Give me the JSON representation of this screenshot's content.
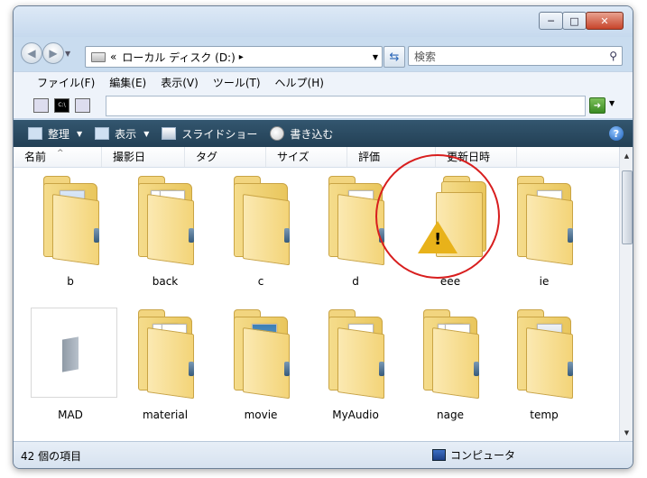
{
  "window": {
    "controls": {
      "minimize": "─",
      "maximize": "□",
      "close": "✕"
    }
  },
  "nav": {
    "back_glyph": "◀",
    "forward_glyph": "▶",
    "address": {
      "prefix": "«",
      "location": "ローカル ディスク (D:)",
      "separator": "▸"
    },
    "search_placeholder": "検索"
  },
  "menu": [
    "ファイル(F)",
    "編集(E)",
    "表示(V)",
    "ツール(T)",
    "ヘルプ(H)"
  ],
  "toolbar2": {
    "cmd_label": "C:\\"
  },
  "command_bar": {
    "organize": "整理",
    "view": "表示",
    "slideshow": "スライドショー",
    "burn": "書き込む",
    "help": "?"
  },
  "columns": [
    "名前",
    "撮影日",
    "タグ",
    "サイズ",
    "評価",
    "更新日時"
  ],
  "items": [
    {
      "name": "b"
    },
    {
      "name": "back"
    },
    {
      "name": "c"
    },
    {
      "name": "d"
    },
    {
      "name": "eee"
    },
    {
      "name": "ie"
    },
    {
      "name": "MAD"
    },
    {
      "name": "material"
    },
    {
      "name": "movie"
    },
    {
      "name": "MyAudio"
    },
    {
      "name": "nage"
    },
    {
      "name": "temp"
    }
  ],
  "status": {
    "count": "42 個の項目",
    "zone": "コンピュータ"
  },
  "colors": {
    "annotation_circle": "#d81e1e",
    "command_bar": "#2b4a61"
  }
}
